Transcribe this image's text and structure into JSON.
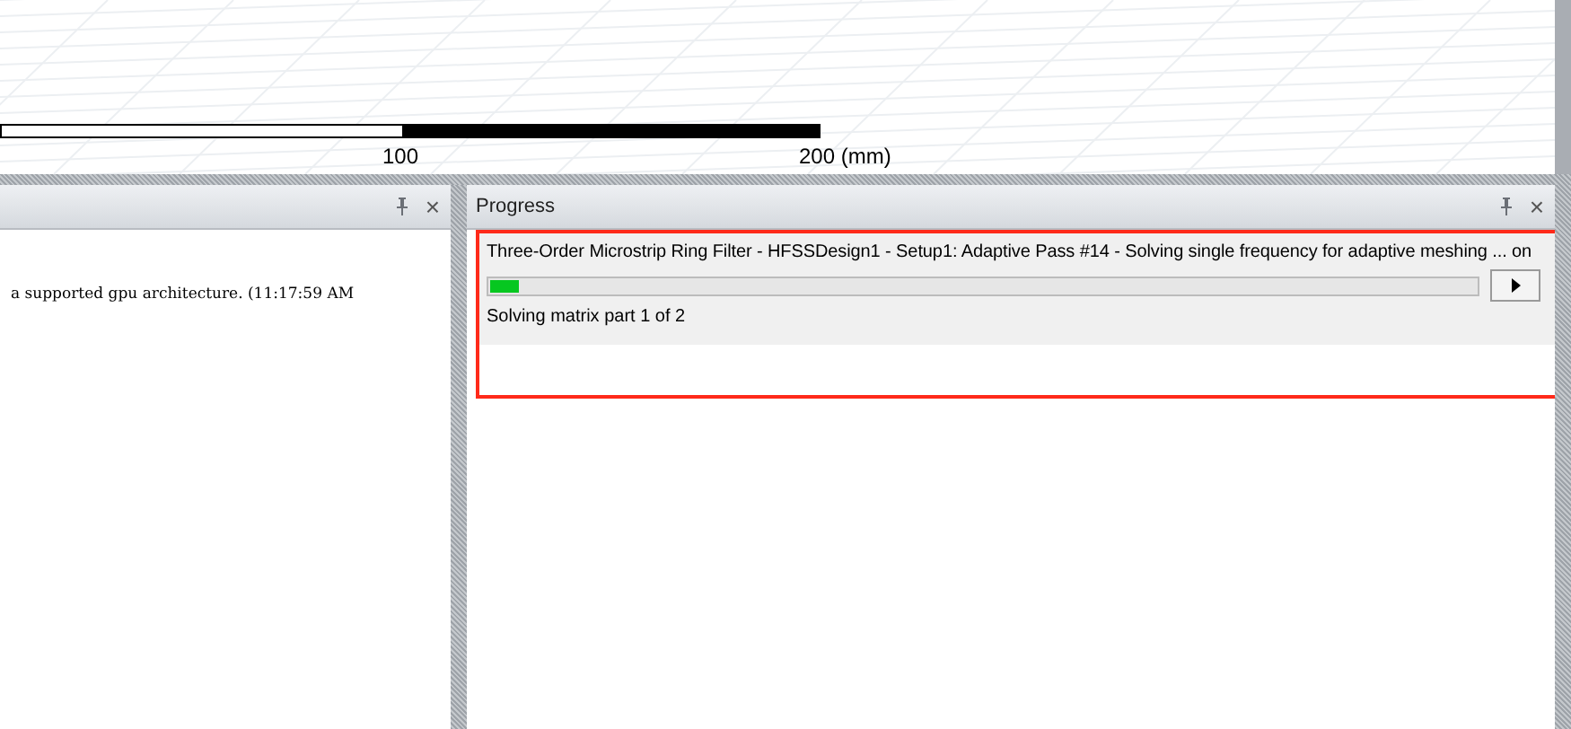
{
  "viewport": {
    "scale_labels": [
      "100",
      "200 (mm)"
    ]
  },
  "message_panel": {
    "close": "×",
    "messages": [
      "a supported gpu architecture. (11:17:59 AM"
    ]
  },
  "progress_panel": {
    "title": "Progress",
    "items": [
      {
        "task": "Three-Order Microstrip Ring Filter - HFSSDesign1 - Setup1: Adaptive Pass #14 - Solving single frequency for adaptive meshing ... on",
        "level": 0.03,
        "status": "Solving matrix part 1 of 2",
        "highlighted": true
      }
    ]
  }
}
